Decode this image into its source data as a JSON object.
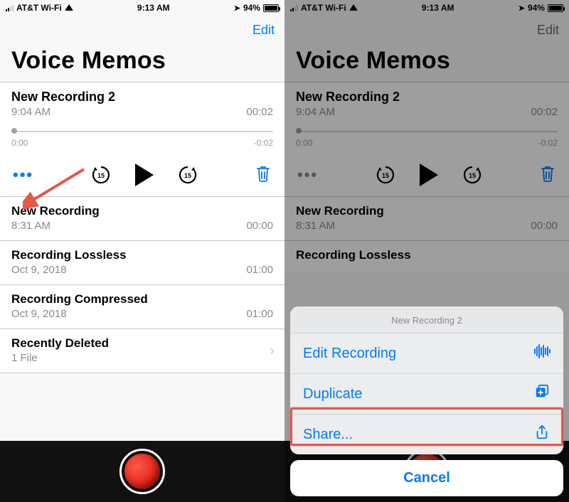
{
  "status": {
    "carrier": "AT&T Wi-Fi",
    "time": "9:13 AM",
    "battery_pct": "94%"
  },
  "nav": {
    "edit": "Edit"
  },
  "title": "Voice Memos",
  "selected": {
    "name": "New Recording 2",
    "time": "9:04 AM",
    "duration": "00:02",
    "scrub_start": "0:00",
    "scrub_end": "-0:02"
  },
  "memos": [
    {
      "name": "New Recording",
      "sub": "8:31 AM",
      "duration": "00:00"
    },
    {
      "name": "Recording Lossless",
      "sub": "Oct 9, 2018",
      "duration": "01:00"
    },
    {
      "name": "Recording Compressed",
      "sub": "Oct 9, 2018",
      "duration": "01:00"
    }
  ],
  "deleted": {
    "label": "Recently Deleted",
    "sub": "1 File"
  },
  "right_partial_row": "Recording Lossless",
  "sheet": {
    "title": "New Recording 2",
    "edit": "Edit Recording",
    "duplicate": "Duplicate",
    "share": "Share...",
    "cancel": "Cancel"
  },
  "colors": {
    "accent": "#007aff",
    "annotation": "#e4594a"
  }
}
